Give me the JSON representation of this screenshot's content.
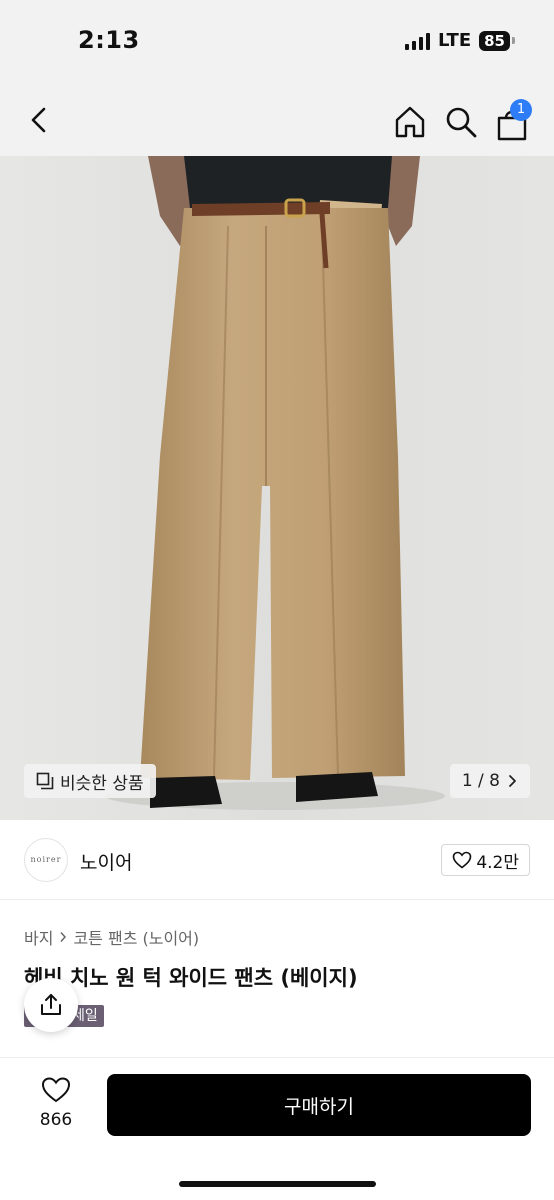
{
  "status_bar": {
    "time": "2:13",
    "network": "LTE",
    "battery": "85"
  },
  "nav": {
    "cart_count": "1"
  },
  "gallery": {
    "similar_label": "비슷한 상품",
    "pager": "1 / 8"
  },
  "brand": {
    "logo_text": "noirer",
    "name": "노이어",
    "likes": "4.2만"
  },
  "breadcrumb": {
    "category": "바지",
    "subcategory": "코튼 팬츠 (노이어)"
  },
  "product": {
    "title": "헤비 치노 원 턱 와이드 팬츠 (베이지)",
    "sale_badge": "세일"
  },
  "bottom": {
    "wish_count": "866",
    "buy_label": "구매하기"
  },
  "colors": {
    "accent_badge": "#2f7df6",
    "sale_badge": "#6b5f74",
    "buy_button": "#000000",
    "pants": "#c2a47a"
  }
}
